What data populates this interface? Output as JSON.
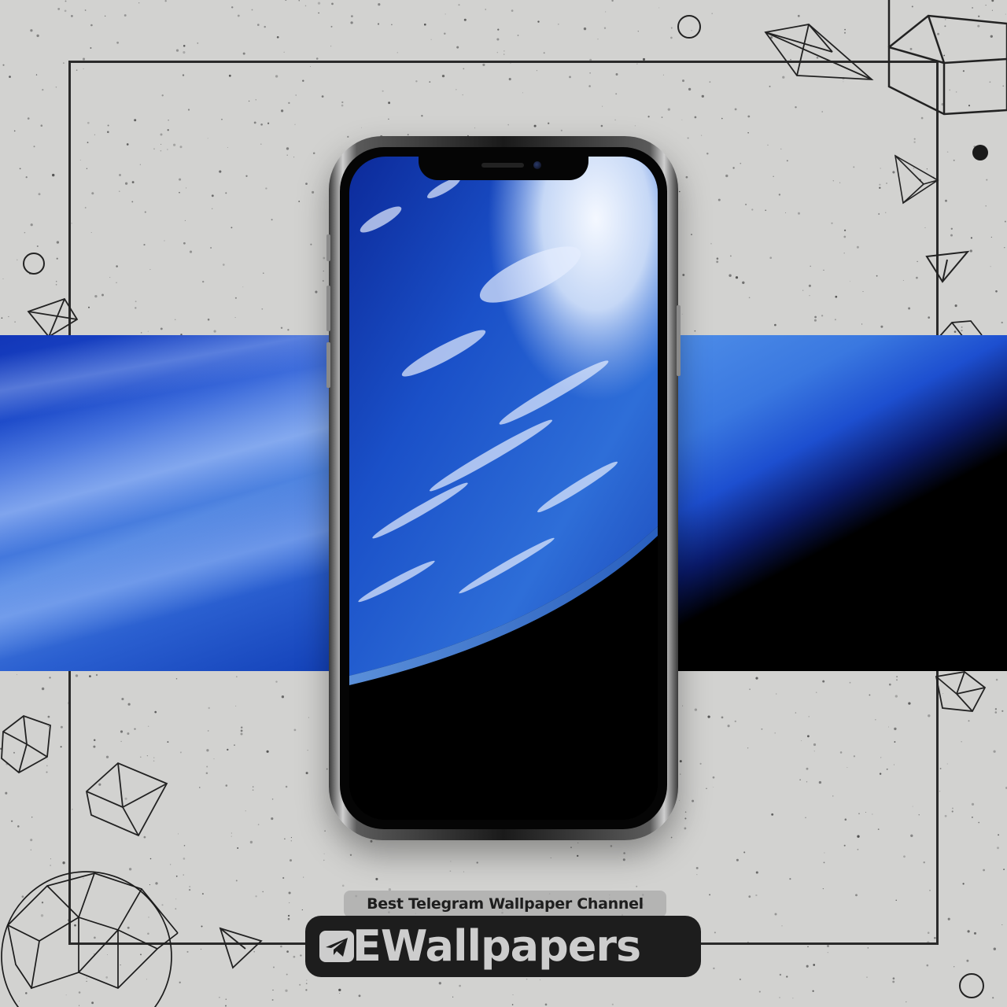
{
  "tagline": "Best Telegram Wallpaper Channel",
  "brand": {
    "name": "EWallpapers",
    "icon": "telegram-icon"
  },
  "colors": {
    "background": "#d2d2d0",
    "band_blue": "#2356d4",
    "brand_bg": "#1d1d1d",
    "brand_text": "#cdcdcd"
  }
}
